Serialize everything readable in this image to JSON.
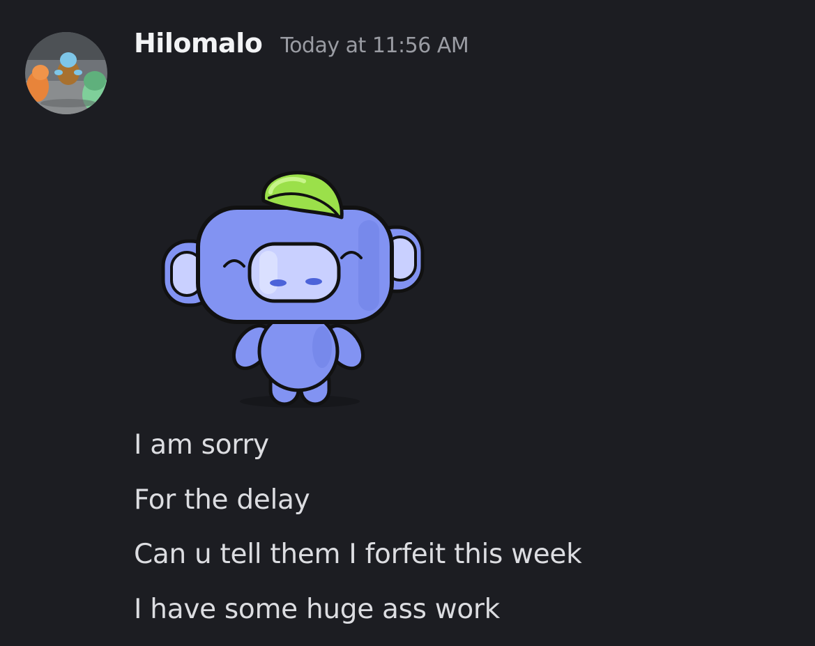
{
  "message": {
    "author": "Hilomalo",
    "timestamp": "Today at 11:56 AM",
    "avatar": "pokemon-starters-avatar",
    "sticker": "wumpus-leaf-sticker",
    "lines": [
      "I am sorry",
      "For the delay",
      "Can u tell them I forfeit this week",
      "I have some huge ass work"
    ]
  },
  "colors": {
    "background": "#1c1d22",
    "author": "#f2f3f5",
    "timestamp": "#9a9ca3",
    "text": "#dcdde1",
    "wumpus": "#8293f2",
    "leaf": "#9be04a"
  }
}
